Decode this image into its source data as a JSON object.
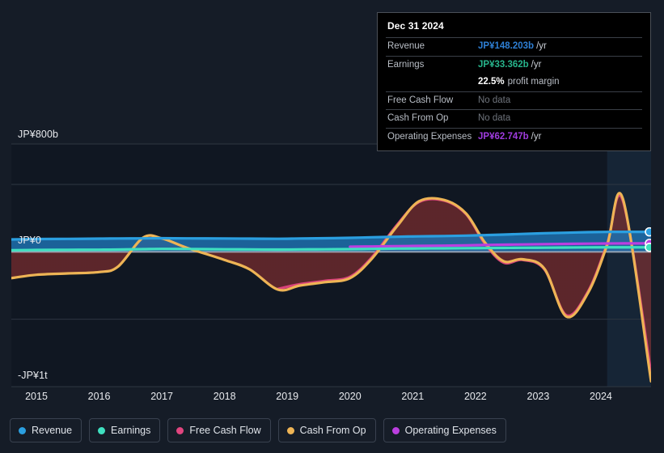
{
  "theme": {
    "background": "#151c27",
    "plot_background": "#101722",
    "grid_color": "#2e3742",
    "zero_line_color": "#b9c0cb",
    "text_color": "#e8eaee",
    "forecast_band": "#16283a"
  },
  "tooltip": {
    "date": "Dec 31 2024",
    "rows": [
      {
        "label": "Revenue",
        "value": "JP¥148.203b",
        "unit": "/yr",
        "color": "#2e7fd4",
        "no_data": false
      },
      {
        "label": "Earnings",
        "value": "JP¥33.362b",
        "unit": "/yr",
        "color": "#27b58c",
        "no_data": false
      },
      {
        "label": "",
        "margin_value": "22.5%",
        "margin_label": "profit margin",
        "is_margin": true
      },
      {
        "label": "Free Cash Flow",
        "value": "No data",
        "unit": "",
        "color": "#6f747c",
        "no_data": true
      },
      {
        "label": "Cash From Op",
        "value": "No data",
        "unit": "",
        "color": "#6f747c",
        "no_data": true
      },
      {
        "label": "Operating Expenses",
        "value": "JP¥62.747b",
        "unit": "/yr",
        "color": "#a03ce0",
        "no_data": false
      }
    ]
  },
  "legend": {
    "items": [
      {
        "label": "Revenue",
        "color": "#2b9fe0"
      },
      {
        "label": "Earnings",
        "color": "#3fe0c0"
      },
      {
        "label": "Free Cash Flow",
        "color": "#e0457f"
      },
      {
        "label": "Cash From Op",
        "color": "#eeb455"
      },
      {
        "label": "Operating Expenses",
        "color": "#bb3fe0"
      }
    ]
  },
  "axes": {
    "y_labels": [
      "JP¥800b",
      "JP¥0",
      "-JP¥1t"
    ],
    "x_labels": [
      "2015",
      "2016",
      "2017",
      "2018",
      "2019",
      "2020",
      "2021",
      "2022",
      "2023",
      "2024"
    ]
  },
  "chart_data": {
    "type": "area",
    "title": "",
    "xlabel": "",
    "ylabel": "",
    "ylim": [
      -1000,
      800
    ],
    "y_unit": "JP¥ billions",
    "ytick_values": [
      800,
      0,
      -1000
    ],
    "ytick_labels": [
      "JP¥800b",
      "JP¥0",
      "-JP¥1t"
    ],
    "gridlines": [
      800,
      500,
      0,
      -500,
      -1000
    ],
    "grid": true,
    "legend_position": "bottom",
    "x": [
      2014.6,
      2015,
      2015.5,
      2016,
      2016.3,
      2016.7,
      2017,
      2017.4,
      2018,
      2018.4,
      2018.85,
      2019.2,
      2019.6,
      2020,
      2020.35,
      2020.75,
      2021.1,
      2021.5,
      2021.85,
      2022.15,
      2022.45,
      2022.75,
      2023.1,
      2023.45,
      2023.8,
      2024.1,
      2024.35,
      2024.8
    ],
    "x_axis_ticks": [
      2015,
      2016,
      2017,
      2018,
      2019,
      2020,
      2021,
      2022,
      2023,
      2024
    ],
    "forecast_start_x": 2024.1,
    "series": [
      {
        "name": "Revenue",
        "color": "#2b9fe0",
        "filled": true,
        "values": [
          92,
          95,
          96,
          98,
          99,
          100,
          101,
          100,
          99,
          98,
          97,
          99,
          101,
          104,
          108,
          112,
          115,
          117,
          120,
          124,
          128,
          133,
          138,
          142,
          146,
          148,
          148.203,
          148.203
        ],
        "end_value_label": "JP¥148.203b"
      },
      {
        "name": "Earnings",
        "color": "#3fe0c0",
        "filled": false,
        "values": [
          12,
          14,
          15,
          16,
          17,
          20,
          22,
          21,
          19,
          18,
          17,
          18,
          19,
          20,
          22,
          24,
          25,
          26,
          27,
          28,
          29,
          30,
          31,
          32,
          33,
          33.3,
          33.362,
          33.362
        ],
        "end_value_label": "JP¥33.362b"
      },
      {
        "name": "Free Cash Flow",
        "color": "#e0457f",
        "filled": false,
        "starts_at_x": 2018.85,
        "values": [
          null,
          null,
          null,
          null,
          null,
          null,
          null,
          null,
          null,
          null,
          -275,
          -240,
          -215,
          -185,
          -40,
          200,
          370,
          380,
          280,
          60,
          -80,
          -60,
          -130,
          -470,
          -290,
          60,
          380,
          -900
        ],
        "end_value_label": "No data"
      },
      {
        "name": "Cash From Op",
        "color": "#eeb455",
        "filled": true,
        "values": [
          -195,
          -170,
          -160,
          -150,
          -110,
          105,
          100,
          30,
          -60,
          -130,
          -280,
          -250,
          -225,
          -195,
          -50,
          190,
          375,
          385,
          285,
          70,
          -70,
          -55,
          -125,
          -480,
          -300,
          50,
          395,
          -960
        ],
        "end_value_label": "No data"
      },
      {
        "name": "Operating Expenses",
        "color": "#bb3fe0",
        "filled": false,
        "starts_at_x": 2020,
        "values": [
          null,
          null,
          null,
          null,
          null,
          null,
          null,
          null,
          null,
          null,
          null,
          null,
          null,
          38,
          40,
          42,
          44,
          46,
          48,
          51,
          53,
          55,
          57,
          59,
          61,
          62,
          62.747,
          62.747
        ],
        "end_value_label": "JP¥62.747b"
      }
    ]
  }
}
